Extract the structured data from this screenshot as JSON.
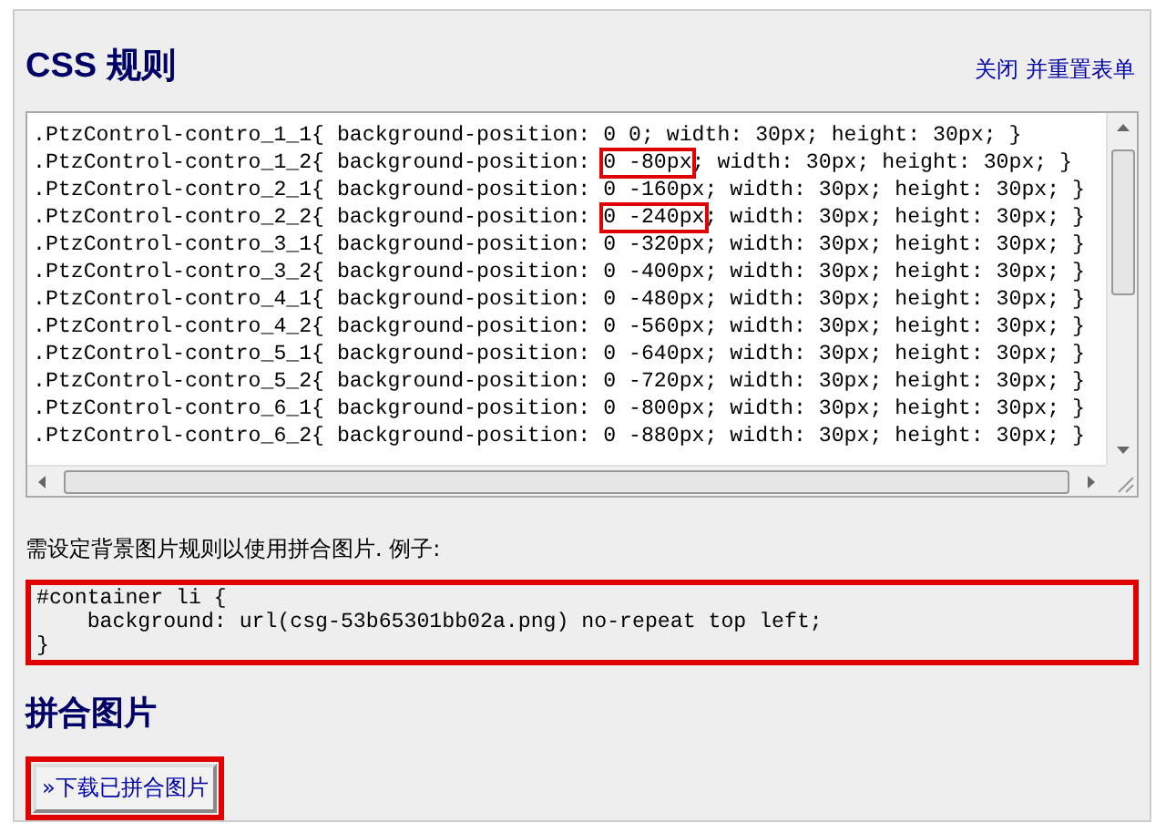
{
  "header": {
    "title": "CSS 规则",
    "link": "关闭 并重置表单"
  },
  "css_rules": [
    {
      "prefix": ".PtzControl-contro_1_1{ background-position: ",
      "value": "0 0",
      "suffix": "; width: 30px; height: 30px; }",
      "highlighted": false
    },
    {
      "prefix": ".PtzControl-contro_1_2{ background-position: ",
      "value": "0 -80px",
      "suffix": "; width: 30px; height: 30px; }",
      "highlighted": true
    },
    {
      "prefix": ".PtzControl-contro_2_1{ background-position: ",
      "value": "0 -160px",
      "suffix": "; width: 30px; height: 30px; }",
      "highlighted": false
    },
    {
      "prefix": ".PtzControl-contro_2_2{ background-position: ",
      "value": "0 -240px",
      "suffix": "; width: 30px; height: 30px; }",
      "highlighted": true
    },
    {
      "prefix": ".PtzControl-contro_3_1{ background-position: ",
      "value": "0 -320px",
      "suffix": "; width: 30px; height: 30px; }",
      "highlighted": false
    },
    {
      "prefix": ".PtzControl-contro_3_2{ background-position: ",
      "value": "0 -400px",
      "suffix": "; width: 30px; height: 30px; }",
      "highlighted": false
    },
    {
      "prefix": ".PtzControl-contro_4_1{ background-position: ",
      "value": "0 -480px",
      "suffix": "; width: 30px; height: 30px; }",
      "highlighted": false
    },
    {
      "prefix": ".PtzControl-contro_4_2{ background-position: ",
      "value": "0 -560px",
      "suffix": "; width: 30px; height: 30px; }",
      "highlighted": false
    },
    {
      "prefix": ".PtzControl-contro_5_1{ background-position: ",
      "value": "0 -640px",
      "suffix": "; width: 30px; height: 30px; }",
      "highlighted": false
    },
    {
      "prefix": ".PtzControl-contro_5_2{ background-position: ",
      "value": "0 -720px",
      "suffix": "; width: 30px; height: 30px; }",
      "highlighted": false
    },
    {
      "prefix": ".PtzControl-contro_6_1{ background-position: ",
      "value": "0 -800px",
      "suffix": "; width: 30px; height: 30px; }",
      "highlighted": false
    },
    {
      "prefix": ".PtzControl-contro_6_2{ background-position: ",
      "value": "0 -880px",
      "suffix": "; width: 30px; height: 30px; }",
      "highlighted": false
    }
  ],
  "instruction": "需设定背景图片规则以使用拼合图片. 例子:",
  "example_code": [
    "#container li {",
    "    background: url(csg-53b65301bb02a.png) no-repeat top left;",
    "}"
  ],
  "sprite_section": {
    "title": "拼合图片",
    "button": "»下载已拼合图片"
  }
}
